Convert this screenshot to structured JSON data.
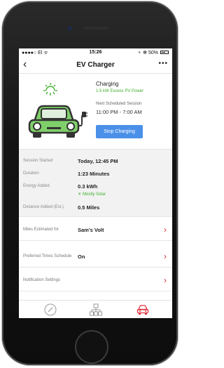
{
  "status_bar": {
    "carrier": "●●●●○ El ᯤ",
    "time": "15:26",
    "battery": "⚬ ✻ 50%"
  },
  "nav": {
    "back_icon": "chevron-left-icon",
    "title": "EV Charger",
    "more_icon": "more-icon"
  },
  "charging": {
    "status": "Charging",
    "power": "1.5 kW Excess PV Power",
    "next_label": "Next Scheduled Session",
    "next_time": "11:00 PM - 7:00 AM",
    "stop_button": "Stop Charging"
  },
  "session": {
    "rows": [
      {
        "label": "Session Started",
        "value": "Today, 12:45 PM"
      },
      {
        "label": "Duration",
        "value": "1:23 Minutes"
      },
      {
        "label": "Energy Added",
        "value": "0.3 kWh",
        "sub": "Mostly Solar"
      },
      {
        "label": "Distance Added  (Est.)",
        "value": "0.5 Miles"
      }
    ]
  },
  "settings": [
    {
      "label": "Miles Estimated for",
      "value": "Sam's Volt"
    },
    {
      "label": "Preferred Times Schedule",
      "value": "On"
    },
    {
      "label": "Notification Settings",
      "value": ""
    }
  ],
  "tabs": [
    {
      "icon": "gauge-icon"
    },
    {
      "icon": "network-icon"
    },
    {
      "icon": "car-icon"
    }
  ],
  "colors": {
    "accent_green": "#3fae2a",
    "button_blue": "#4a90e8",
    "chevron_red": "#e0303a"
  }
}
